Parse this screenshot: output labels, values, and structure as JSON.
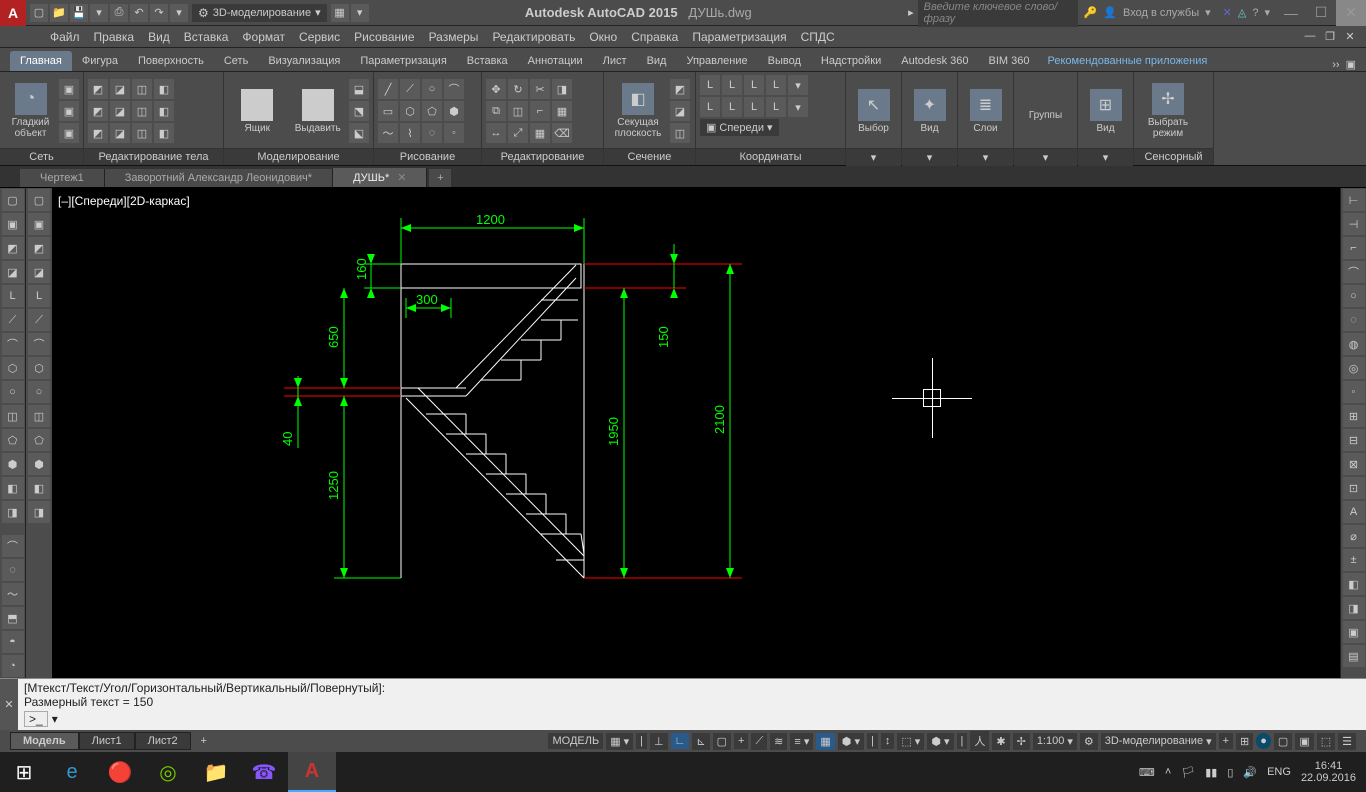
{
  "app": {
    "name": "Autodesk AutoCAD 2015",
    "file": "ДУШь.dwg"
  },
  "workspace": "3D-моделирование",
  "search_placeholder": "Введите ключевое слово/фразу",
  "login": "Вход в службы",
  "menu": [
    "Файл",
    "Правка",
    "Вид",
    "Вставка",
    "Формат",
    "Сервис",
    "Рисование",
    "Размеры",
    "Редактировать",
    "Окно",
    "Справка",
    "Параметризация",
    "СПДС"
  ],
  "ribtabs": {
    "active": "Главная",
    "others": [
      "Фигура",
      "Поверхность",
      "Сеть",
      "Визуализация",
      "Параметризация",
      "Вставка",
      "Аннотации",
      "Лист",
      "Вид",
      "Управление",
      "Вывод",
      "Надстройки",
      "Autodesk 360",
      "BIM 360"
    ],
    "tail": "Рекомендованные приложения"
  },
  "panels": {
    "network": {
      "label": "Сеть",
      "btn": "Гладкий объект"
    },
    "editbody": {
      "label": "Редактирование тела"
    },
    "modeling": {
      "label": "Моделирование",
      "b1": "Ящик",
      "b2": "Выдавить"
    },
    "draw": {
      "label": "Рисование"
    },
    "edit": {
      "label": "Редактирование"
    },
    "section": {
      "label": "Сечение",
      "btn": "Секущая плоскость"
    },
    "coords": {
      "label": "Координаты",
      "front": "Спереди"
    },
    "sel": {
      "label": "",
      "btn": "Выбор"
    },
    "view": {
      "label": "",
      "btn": "Вид"
    },
    "layers": {
      "label": "",
      "btn": "Слои"
    },
    "groups": {
      "label": "",
      "btn": "Группы"
    },
    "view2": {
      "label": "",
      "btn": "Вид"
    },
    "touch": {
      "label": "Сенсорный",
      "btn": "Выбрать режим"
    }
  },
  "doctabs": {
    "t1": "Чертеж1",
    "t2": "Заворотний Александр Леонидович*",
    "t3": "ДУШЬ*"
  },
  "viewport_label": "[–][Спереди][2D-каркас]",
  "dims": {
    "d1200": "1200",
    "d160": "160",
    "d300": "300",
    "d150": "150",
    "d1950": "1950",
    "d2100": "2100",
    "d1250": "1250",
    "d40": "40",
    "d650": "650"
  },
  "cmd": {
    "line1": "[Мтекст/Текст/Угол/Горизонтальный/Вертикальный/Повернутый]:",
    "line2": "Размерный текст = 150"
  },
  "layouts": {
    "model": "Модель",
    "l1": "Лист1",
    "l2": "Лист2"
  },
  "status": {
    "model": "МОДЕЛЬ",
    "scale": "1:100",
    "ws": "3D-моделирование"
  },
  "taskbar": {
    "lang": "ENG",
    "time": "16:41",
    "date": "22.09.2016"
  }
}
